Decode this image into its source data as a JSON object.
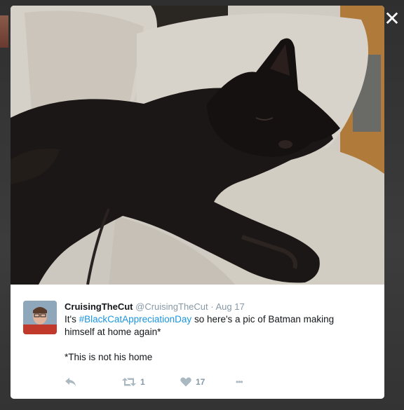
{
  "close": {
    "label": "✕"
  },
  "photo": {
    "alt_icon": "black-cat-photo"
  },
  "tweet": {
    "display_name": "CruisingTheCut",
    "handle": "@CruisingTheCut",
    "separator": "·",
    "date": "Aug 17",
    "text_before": "It's ",
    "hashtag": "#BlackCatAppreciationDay",
    "text_after": " so here's a pic of Batman making himself at home again*",
    "footnote": "*This is not his home"
  },
  "actions": {
    "reply_icon": "reply-icon",
    "retweet_icon": "retweet-icon",
    "retweet_count": "1",
    "like_icon": "heart-icon",
    "like_count": "17",
    "more_icon": "more-icon",
    "more_label": "•••"
  },
  "colors": {
    "hashtag": "#1b95e0",
    "muted": "#8899a6",
    "icon": "#aab8c2"
  }
}
